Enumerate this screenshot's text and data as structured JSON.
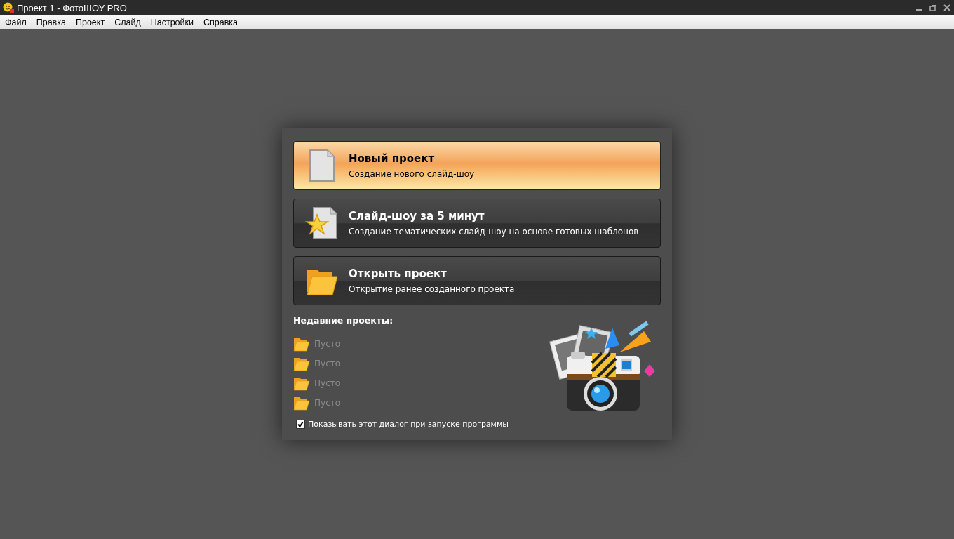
{
  "window": {
    "title": "Проект 1 - ФотоШОУ PRO"
  },
  "menu": [
    "Файл",
    "Правка",
    "Проект",
    "Слайд",
    "Настройки",
    "Справка"
  ],
  "actions": [
    {
      "kind": "new",
      "title": "Новый проект",
      "subtitle": "Создание нового слайд-шоу",
      "selected": true
    },
    {
      "kind": "template",
      "title": "Слайд-шоу за 5 минут",
      "subtitle": "Создание тематических слайд-шоу на основе готовых шаблонов",
      "selected": false
    },
    {
      "kind": "open",
      "title": "Открыть проект",
      "subtitle": "Открытие ранее созданного проекта",
      "selected": false
    }
  ],
  "recent": {
    "heading": "Недавние проекты:",
    "items": [
      {
        "label": "Пусто",
        "disabled": true
      },
      {
        "label": "Пусто",
        "disabled": true
      },
      {
        "label": "Пусто",
        "disabled": true
      },
      {
        "label": "Пусто",
        "disabled": true
      }
    ]
  },
  "startup_checkbox": {
    "label": "Показывать этот диалог при запуске программы",
    "checked": true
  }
}
